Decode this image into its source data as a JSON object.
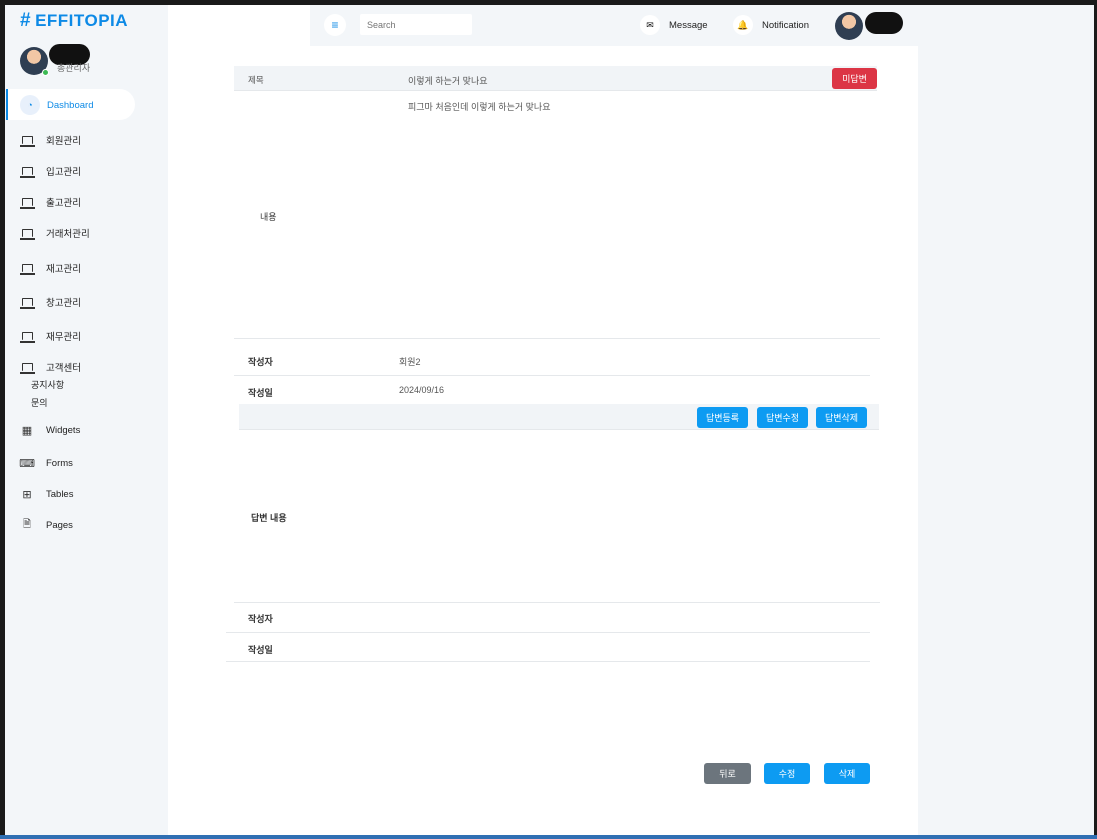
{
  "brand": {
    "hash": "#",
    "name": "EFFITOPIA"
  },
  "profile": {
    "role": "총관리자"
  },
  "sidebar": {
    "active": {
      "label": "Dashboard",
      "icon": "gauge-icon"
    },
    "items": [
      {
        "label": "회원관리",
        "icon": "laptop-icon"
      },
      {
        "label": "입고관리",
        "icon": "laptop-icon"
      },
      {
        "label": "출고관리",
        "icon": "laptop-icon"
      },
      {
        "label": "거래처관리",
        "icon": "laptop-icon"
      },
      {
        "label": "재고관리",
        "icon": "laptop-icon"
      },
      {
        "label": "창고관리",
        "icon": "laptop-icon"
      },
      {
        "label": "재무관리",
        "icon": "laptop-icon"
      },
      {
        "label": "고객센터",
        "icon": "laptop-icon"
      }
    ],
    "sub_items": [
      "공지사항",
      "문의"
    ],
    "extras": [
      {
        "label": "Widgets",
        "icon": "grid-icon"
      },
      {
        "label": "Forms",
        "icon": "keyboard-icon"
      },
      {
        "label": "Tables",
        "icon": "table-icon"
      },
      {
        "label": "Pages",
        "icon": "file-icon"
      }
    ]
  },
  "topbar": {
    "search_placeholder": "Search",
    "message_label": "Message",
    "notification_label": "Notification"
  },
  "inquiry": {
    "title_label": "제목",
    "title_value": "이렇게 하는거 맞나요",
    "status_badge": "미답변",
    "content_label": "내용",
    "content_value": "피그마 처음인데 이렇게 하는거 맞나요",
    "author_label": "작성자",
    "author_value": "회원2",
    "date_label": "작성일",
    "date_value": "2024/09/16"
  },
  "answer": {
    "register_button": "답변등록",
    "edit_button": "답변수정",
    "delete_button": "답변삭제",
    "content_label": "답변 내용",
    "content_value": "",
    "author_label": "작성자",
    "author_value": "",
    "date_label": "작성일",
    "date_value": ""
  },
  "footer_actions": {
    "back_button": "뒤로",
    "edit_button": "수정",
    "delete_button": "삭제"
  },
  "colors": {
    "brand": "#0d8ae6",
    "danger": "#dc3545",
    "primary": "#0d9bf2",
    "secondary": "#6c757d"
  }
}
